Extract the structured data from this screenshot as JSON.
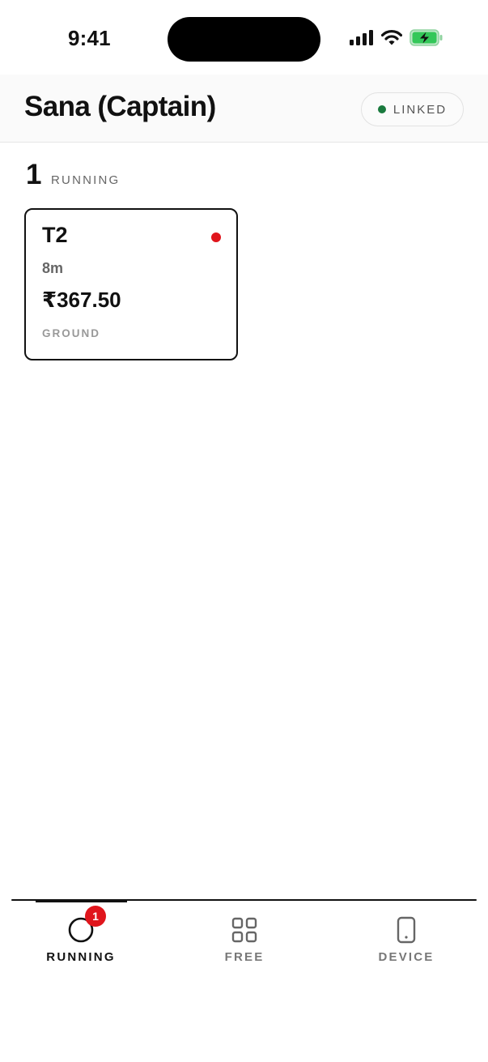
{
  "status_bar": {
    "time": "9:41",
    "icons": [
      "cellular-signal-icon",
      "wifi-icon",
      "battery-charging-icon"
    ]
  },
  "header": {
    "title": "Sana (Captain)",
    "link_status": "LINKED",
    "link_status_color": "#1a7a3e"
  },
  "running_section": {
    "count": "1",
    "label": "RUNNING"
  },
  "orders": [
    {
      "table": "T2",
      "duration": "8m",
      "amount": "₹367.50",
      "area": "GROUND",
      "status_color": "#e0151c"
    }
  ],
  "tabs": [
    {
      "label": "RUNNING",
      "icon": "circle-icon",
      "badge": "1",
      "active": true
    },
    {
      "label": "FREE",
      "icon": "grid-icon",
      "active": false
    },
    {
      "label": "DEVICE",
      "icon": "phone-icon",
      "active": false
    }
  ],
  "colors": {
    "accent": "#111111",
    "alert": "#e0151c",
    "battery": "#34c759"
  }
}
